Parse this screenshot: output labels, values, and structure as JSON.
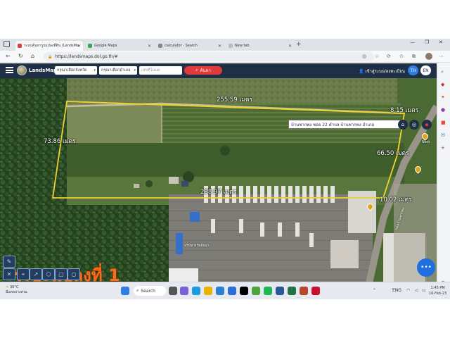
{
  "browser": {
    "tabs": [
      {
        "title": "ระบบค้นหารูปแปลงที่ดิน (LandsMaps",
        "favicon": "map-pin-icon",
        "active": true
      },
      {
        "title": "Google Maps",
        "favicon": "google-maps-icon",
        "active": false
      },
      {
        "title": "calculator - Search",
        "favicon": "search-icon",
        "active": false
      },
      {
        "title": "New tab",
        "favicon": "newtab-icon",
        "active": false
      }
    ],
    "url": "https://landsmaps.dol.go.th/#"
  },
  "app": {
    "brand": "LandsMaps",
    "province_select": "กรุณาเลือกจังหวัด",
    "district_select": "กรุณาเลือกอำเภอ",
    "deed_input_placeholder": "เลขที่โฉนด",
    "search_label": "ค้นหา",
    "login_label": "เข้าสู่ระบบ/ลงทะเบียน",
    "lang_th": "TH",
    "lang_en": "EN"
  },
  "map": {
    "address_popup": "บ้านชากพง ซอย 22 ตำบล บ้านชากพง อำเภอ",
    "measurements": {
      "top": "255.59 เมตร",
      "left": "73.86 เมตร",
      "right_top": "8.15 เมตร",
      "right": "66.50 เมตร",
      "bottom": "238.97 เมตร",
      "bottom_right": "10.02 เมตร"
    },
    "plot_label": "ระยะแปลงที่ 1",
    "place_labels": {
      "shop": "บริษัท ทรัพย์ธนา",
      "shop2": "Nest",
      "road": "ถนนบ้านชากพง"
    },
    "colors": {
      "parcel_outline": "#f2d22e",
      "plot_label": "#ff6a1a",
      "search_button": "#e23a3a"
    }
  },
  "taskbar": {
    "weather_temp": "30°C",
    "weather_desc": "มีแดดบางส่วน",
    "search_label": "Search",
    "lang": "ENG",
    "time": "1:45 PM",
    "date": "16-Feb-23"
  }
}
